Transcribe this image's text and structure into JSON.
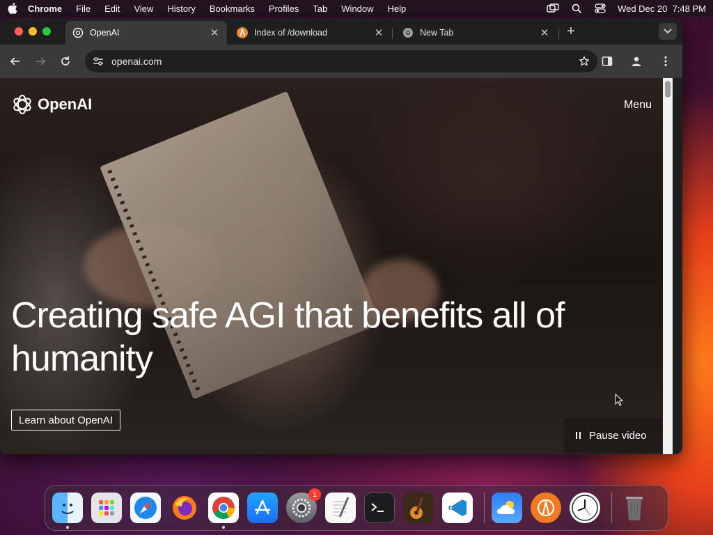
{
  "menubar": {
    "app_name": "Chrome",
    "menus": [
      "File",
      "Edit",
      "View",
      "History",
      "Bookmarks",
      "Profiles",
      "Tab",
      "Window",
      "Help"
    ],
    "datetime": "Wed Dec 20  7:48 PM"
  },
  "browser": {
    "tabs": [
      {
        "title": "OpenAI",
        "active": true,
        "favicon": "openai-icon"
      },
      {
        "title": "Index of /download",
        "active": false,
        "favicon": "download-site-icon"
      },
      {
        "title": "New Tab",
        "active": false,
        "favicon": "chrome-icon"
      }
    ],
    "url": "openai.com"
  },
  "page": {
    "logo_text": "OpenAI",
    "menu_label": "Menu",
    "hero_title": "Creating safe AGI that benefits all of humanity",
    "learn_button": "Learn about OpenAI",
    "pause_button": "Pause video"
  },
  "dock": {
    "apps": [
      {
        "name": "Finder",
        "icon": "finder-icon",
        "color": "#2f8cf6",
        "running": true
      },
      {
        "name": "Launchpad",
        "icon": "launchpad-icon",
        "color": "#d9d9e0",
        "running": false
      },
      {
        "name": "Safari",
        "icon": "safari-icon",
        "color": "#1e88e5",
        "running": false
      },
      {
        "name": "Firefox",
        "icon": "firefox-icon",
        "color": "#ff7a18",
        "running": false
      },
      {
        "name": "Chrome",
        "icon": "chrome-icon",
        "color": "#ffffff",
        "running": true
      },
      {
        "name": "App Store",
        "icon": "app-store-icon",
        "color": "#1a8cff",
        "running": false
      },
      {
        "name": "System Settings",
        "icon": "system-settings-icon",
        "color": "#8e8e93",
        "running": false,
        "badge": "1"
      },
      {
        "name": "TextEdit",
        "icon": "textedit-icon",
        "color": "#f5f5f5",
        "running": false
      },
      {
        "name": "Terminal",
        "icon": "terminal-icon",
        "color": "#1c1c1c",
        "running": false
      },
      {
        "name": "GarageBand",
        "icon": "garageband-icon",
        "color": "#3a2a1a",
        "running": false
      },
      {
        "name": "Visual Studio Code",
        "icon": "vscode-icon",
        "color": "#ffffff",
        "running": false
      }
    ],
    "extras": [
      {
        "name": "Weather",
        "icon": "weather-icon",
        "color": "#3b82f6"
      },
      {
        "name": "Anaconda",
        "icon": "anaconda-icon",
        "color": "#f07a22"
      },
      {
        "name": "Clock",
        "icon": "clock-icon",
        "color": "#ffffff"
      },
      {
        "name": "Trash",
        "icon": "trash-icon",
        "color": "#6b6b6b"
      }
    ]
  }
}
